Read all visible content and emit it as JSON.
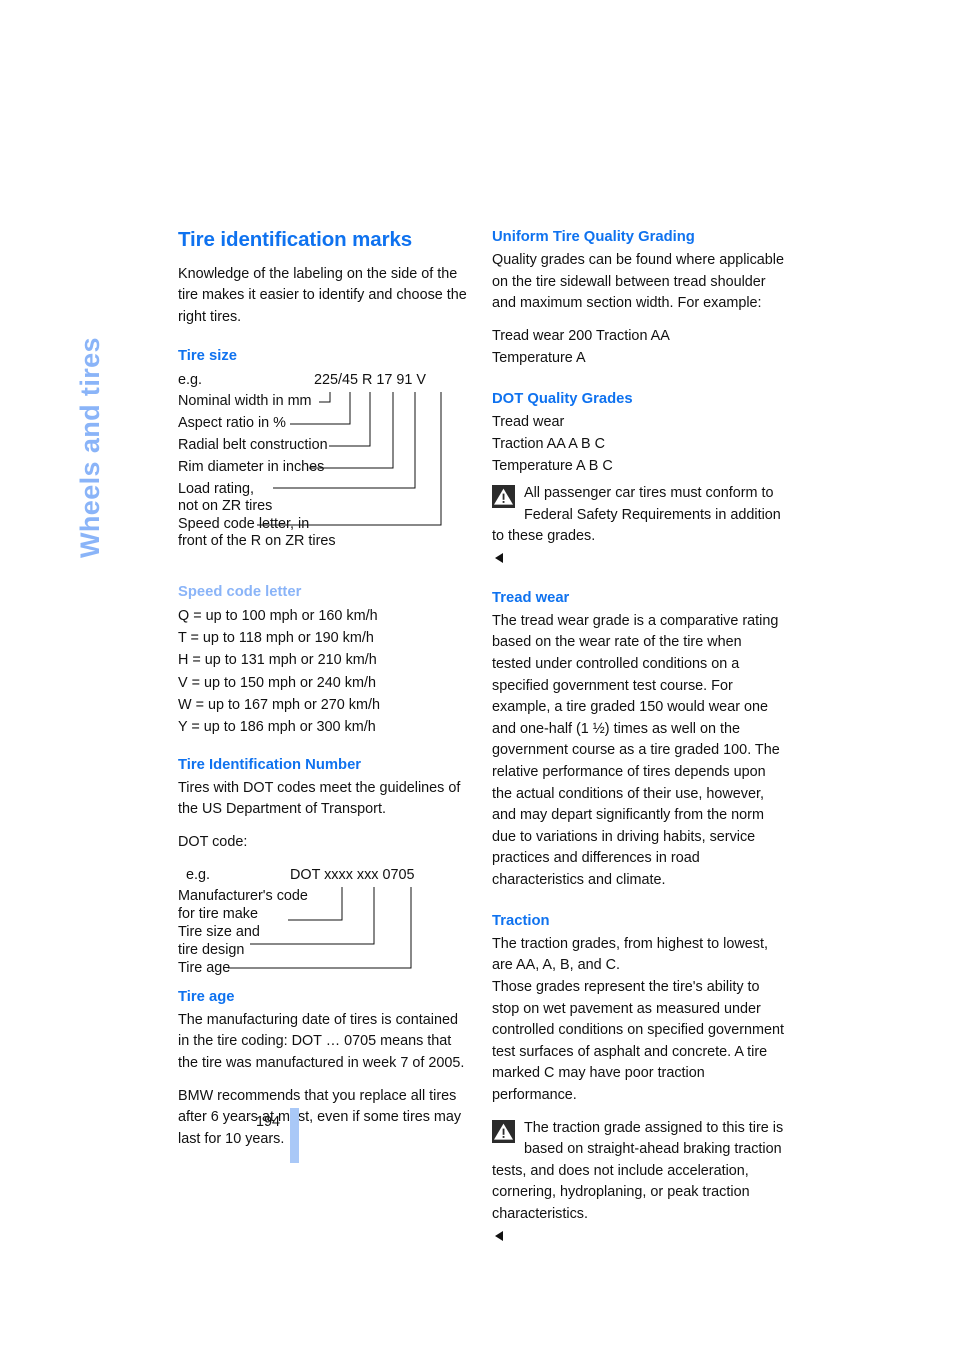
{
  "chapter_tab": {
    "label": "Wheels and tires"
  },
  "page": {
    "number": "194"
  },
  "colors": {
    "heading_blue": "#0f72ef",
    "light_blue": "#8ab4f8",
    "page_bar_blue": "#a9c8f7",
    "body_text": "#111111",
    "warning_icon_bg": "#2b2b2b"
  },
  "left_column": {
    "title": "Tire identification marks",
    "intro": "Knowledge of the labeling on the side of the tire makes it easier to identify and choose the right tires.",
    "tire_size": {
      "heading": "Tire size",
      "example_label": "e.g.",
      "code_parts": [
        "225/45",
        "R",
        "17",
        "91",
        "V"
      ],
      "code_full": "225/45  R  17  91  V",
      "callouts": [
        "Nominal width in mm",
        "Aspect ratio in %",
        "Radial belt construction",
        "Rim diameter in inches",
        "Load rating,",
        "not on ZR tires",
        "Speed code letter, in",
        "front of the R on ZR tires"
      ]
    },
    "speed_code": {
      "heading": "Speed code letter",
      "entries": [
        "Q = up to 100 mph or 160 km/h",
        "T = up to 118 mph or 190 km/h",
        "H = up to 131 mph or 210 km/h",
        "V = up to 150 mph or 240 km/h",
        "W = up to 167 mph or 270 km/h",
        "Y = up to 186 mph or 300 km/h"
      ]
    },
    "tire_id_number": {
      "heading": "Tire Identification Number",
      "body": "Tires with DOT codes meet the guidelines of the US Department of Transport.",
      "dot_label": "DOT code:",
      "example_label": "e.g.",
      "code_full": "DOT xxxx xxx 0705",
      "callouts": [
        "Manufacturer's code",
        "for tire make",
        "Tire size and",
        "tire design",
        "Tire age"
      ]
    },
    "tire_age": {
      "heading": "Tire age",
      "paragraph_1": "The manufacturing date of tires is contained in the tire coding: DOT … 0705 means that the tire was manufactured in week 7 of 2005.",
      "paragraph_2": "BMW recommends that you replace all tires after 6 years at most, even if some tires may last for 10 years."
    }
  },
  "right_column": {
    "uniform_grading": {
      "heading": "Uniform Tire Quality Grading",
      "paragraph": "Quality grades can be found where applicable on the tire sidewall between tread shoulder and maximum section width. For example:",
      "example_lines": [
        "Tread wear 200 Traction AA",
        "Temperature A"
      ]
    },
    "dot_quality_grades": {
      "heading": "DOT Quality Grades",
      "lines": [
        "Tread wear",
        "Traction AA A B C",
        "Temperature A B C"
      ],
      "note": "All passenger car tires must conform to Federal Safety Requirements in addition to these grades."
    },
    "tread_wear": {
      "heading": "Tread wear",
      "paragraph": "The tread wear grade is a comparative rating based on the wear rate of the tire when tested under controlled conditions on a specified government test course. For example, a tire graded 150 would wear one and one-half (1 ½) times as well on the government course as a tire graded 100. The relative performance of tires depends upon the actual conditions of their use, however, and may depart significantly from the norm due to variations in driving habits, service practices and differences in road characteristics and climate."
    },
    "traction": {
      "heading": "Traction",
      "paragraph_1": "The traction grades, from highest to lowest, are AA, A, B, and C.",
      "paragraph_2": "Those grades represent the tire's ability to stop on wet pavement as measured under controlled conditions on specified government test surfaces of asphalt and concrete. A tire marked C may have poor traction performance.",
      "note": "The traction grade assigned to this tire is based on straight-ahead braking traction tests, and does not include acceleration, cornering, hydroplaning, or peak traction characteristics."
    }
  }
}
